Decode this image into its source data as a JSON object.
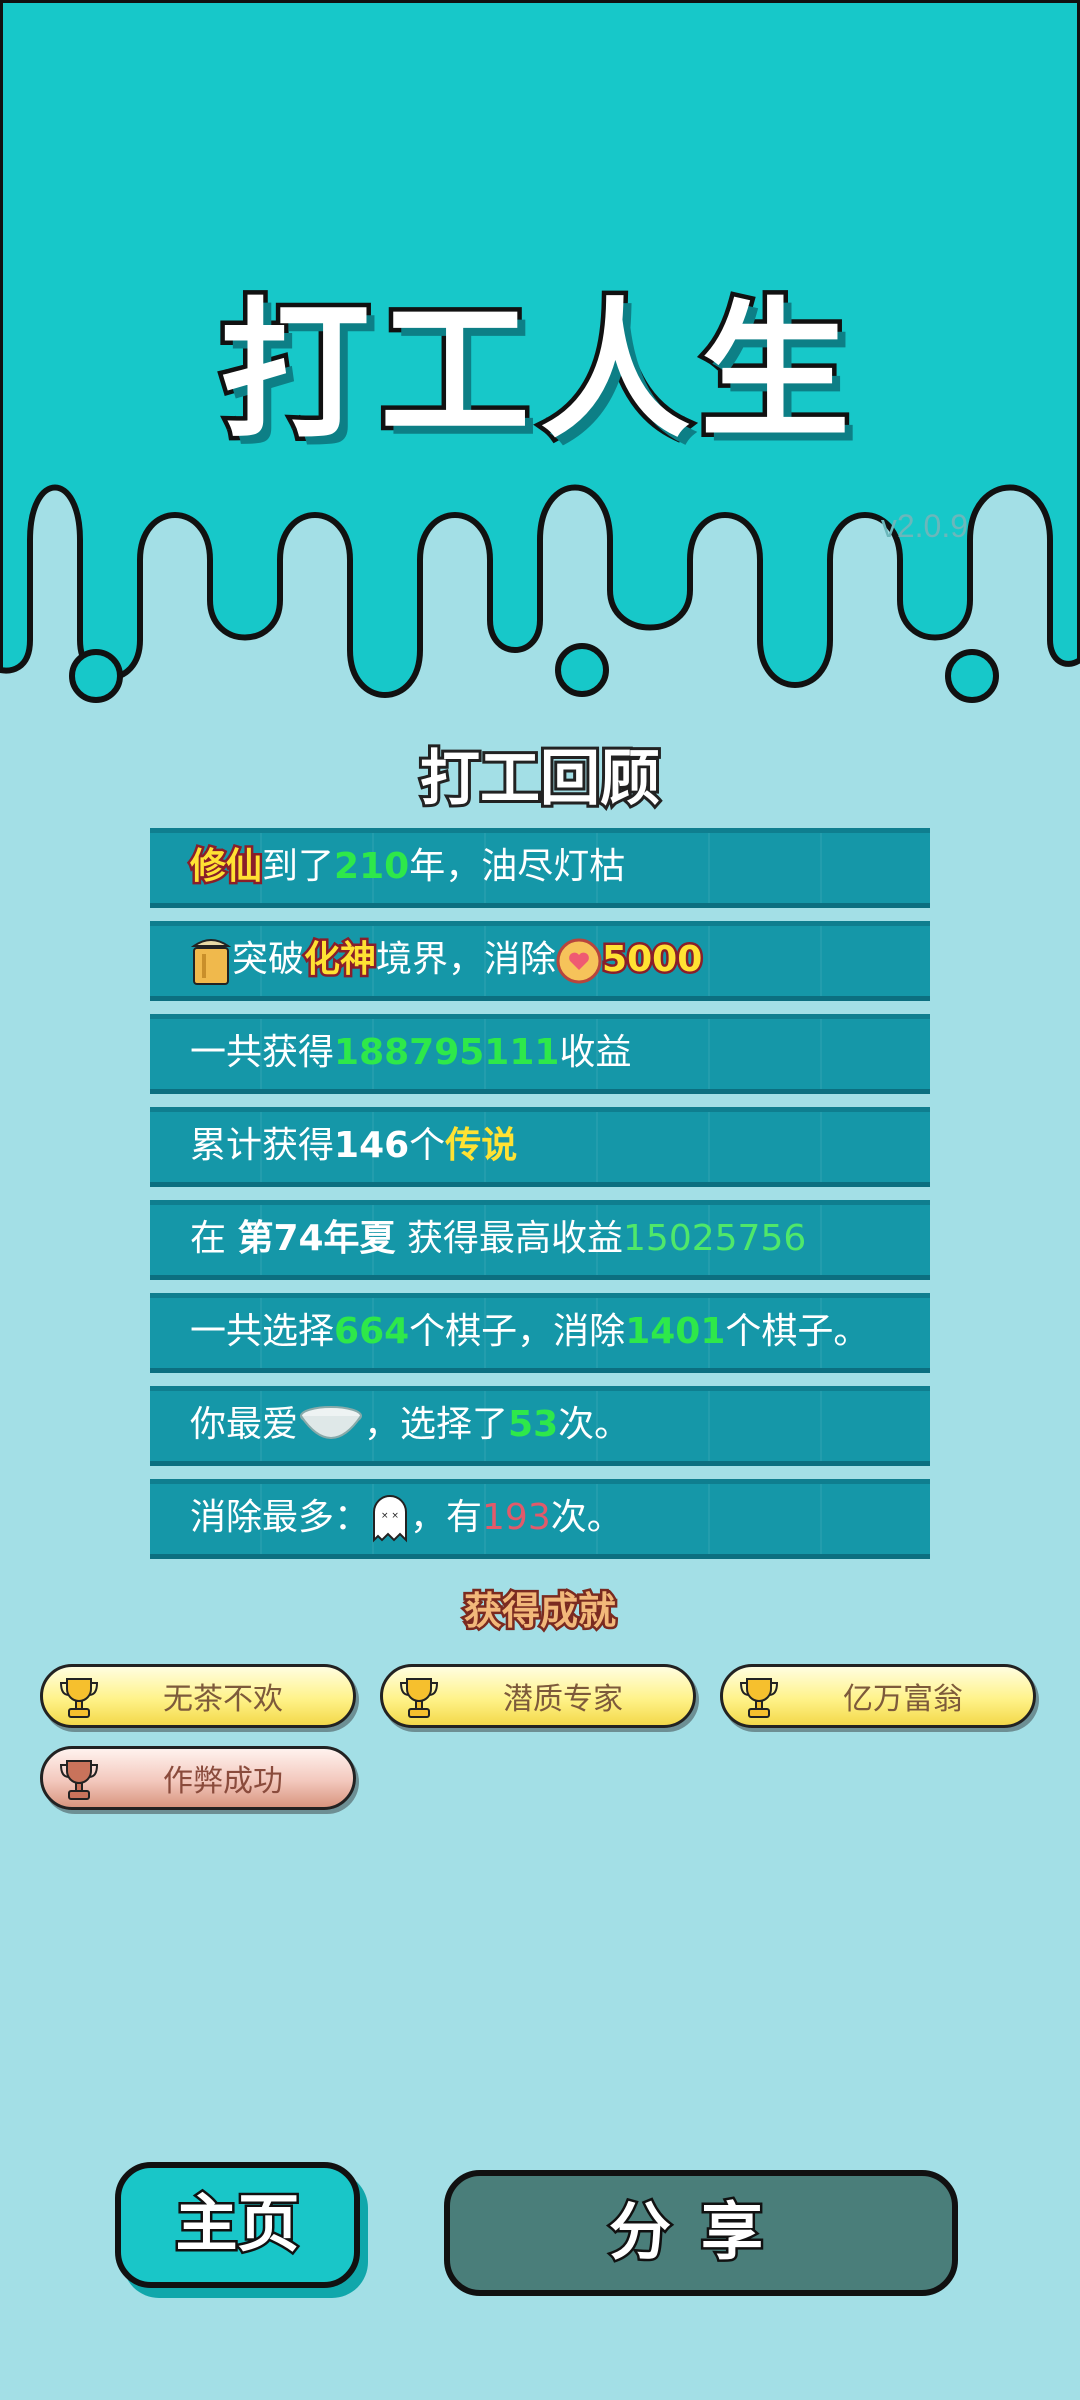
{
  "app": {
    "title": "打工人生",
    "version": "v2.0.9"
  },
  "review": {
    "heading": "打工回顾",
    "rows": [
      {
        "parts": [
          "修仙",
          "到了",
          "210",
          "年，油尽灯枯"
        ]
      },
      {
        "parts": [
          "突破",
          "化神",
          "境界，消除",
          "5000"
        ]
      },
      {
        "parts": [
          "一共获得",
          "188795111",
          "收益"
        ]
      },
      {
        "parts": [
          "累计获得",
          "146",
          "个",
          "传说"
        ]
      },
      {
        "parts": [
          "在 ",
          "第74年夏",
          " 获得最高收益",
          "15025756"
        ]
      },
      {
        "parts": [
          "一共选择",
          "664",
          "个棋子，消除",
          "1401",
          "个棋子。"
        ]
      },
      {
        "parts": [
          "你最爱",
          "，选择了",
          "53",
          "次。"
        ]
      },
      {
        "parts": [
          "消除最多：",
          "，有",
          "193",
          "次。"
        ]
      }
    ]
  },
  "achievements": {
    "heading": "获得成就",
    "items": [
      {
        "label": "无茶不欢",
        "tier": "gold"
      },
      {
        "label": "潜质专家",
        "tier": "gold"
      },
      {
        "label": "亿万富翁",
        "tier": "gold"
      },
      {
        "label": "作弊成功",
        "tier": "bronze"
      }
    ]
  },
  "buttons": {
    "home": "主页",
    "share": "分享"
  },
  "colors": {
    "top_bg": "#17c8c9",
    "page_bg": "#a3dfe6",
    "row_bg": "#1597a8",
    "highlight_green": "#2ee84a",
    "highlight_yellow": "#ffe233",
    "highlight_red": "#e25a6a"
  },
  "icons": [
    "bucket-icon",
    "heart-coin-icon",
    "bowl-icon",
    "ghost-icon",
    "trophy-icon"
  ]
}
